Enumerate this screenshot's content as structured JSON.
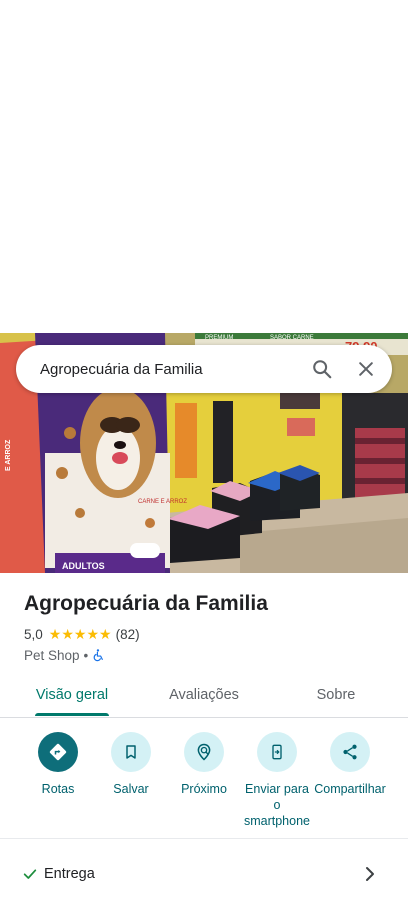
{
  "search": {
    "query": "Agropecuária da Familia"
  },
  "place": {
    "name": "Agropecuária da Familia",
    "rating": "5,0",
    "stars": 5,
    "review_count": "(82)",
    "category": "Pet Shop",
    "separator": "•"
  },
  "photo_text": {
    "bag_brand_side": "E ARROZ",
    "bag_flavor": "CARNE E ARROZ",
    "bag_adults": "ADULTOS",
    "banner_left": "PREMIUM",
    "banner_mid": "SABOR CARNE",
    "banner_price": "79,90"
  },
  "tabs": [
    {
      "label": "Visão geral",
      "active": true
    },
    {
      "label": "Avaliações",
      "active": false
    },
    {
      "label": "Sobre",
      "active": false
    }
  ],
  "actions": [
    {
      "label": "Rotas",
      "icon": "directions-icon"
    },
    {
      "label": "Salvar",
      "icon": "bookmark-icon"
    },
    {
      "label": "Próximo",
      "icon": "nearby-icon"
    },
    {
      "label": "Enviar para o smartphone",
      "icon": "send-to-phone-icon"
    },
    {
      "label": "Compartilhar",
      "icon": "share-icon"
    }
  ],
  "features": [
    {
      "label": "Entrega",
      "icon": "check-icon"
    }
  ],
  "colors": {
    "accent": "#00796b",
    "primary_action": "#0e6e7a",
    "action_bg": "#d4f1f5",
    "star": "#fbbc04"
  }
}
